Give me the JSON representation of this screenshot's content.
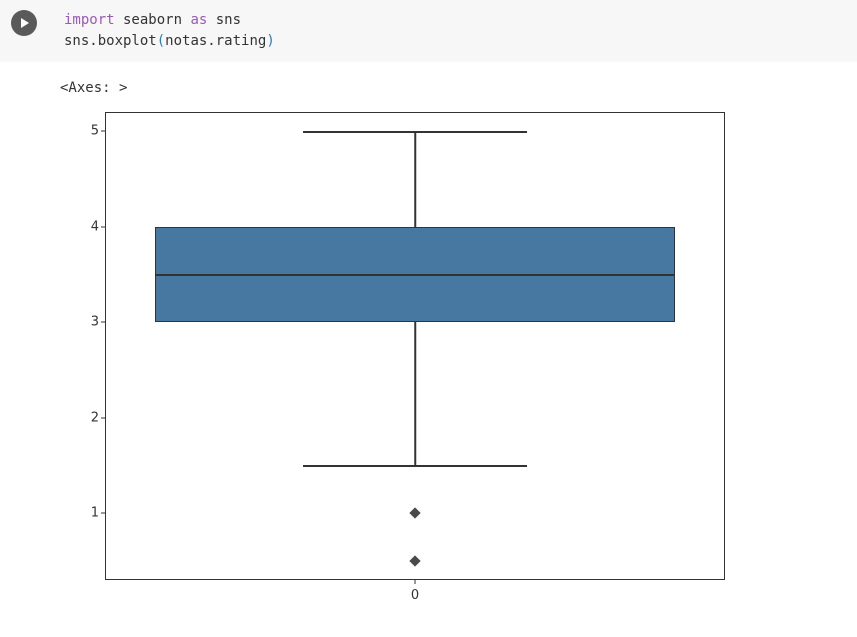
{
  "code": {
    "line1_kw1": "import",
    "line1_id1": " seaborn ",
    "line1_kw2": "as",
    "line1_id2": " sns",
    "line2_pre": "sns.boxplot",
    "line2_open": "(",
    "line2_arg": "notas.rating",
    "line2_close": ")"
  },
  "output_text": "<Axes: >",
  "chart_data": {
    "type": "boxplot",
    "x_tick_labels": [
      "0"
    ],
    "y_tick_labels": [
      "1",
      "2",
      "3",
      "4",
      "5"
    ],
    "y_tick_values": [
      1,
      2,
      3,
      4,
      5
    ],
    "ylim": [
      0.3,
      5.2
    ],
    "series": [
      {
        "category": "0",
        "q1": 3.0,
        "median": 3.5,
        "q3": 4.0,
        "whisker_low": 1.5,
        "whisker_high": 5.0,
        "outliers": [
          1.0,
          0.5
        ]
      }
    ],
    "box_color": "#4678a2"
  }
}
